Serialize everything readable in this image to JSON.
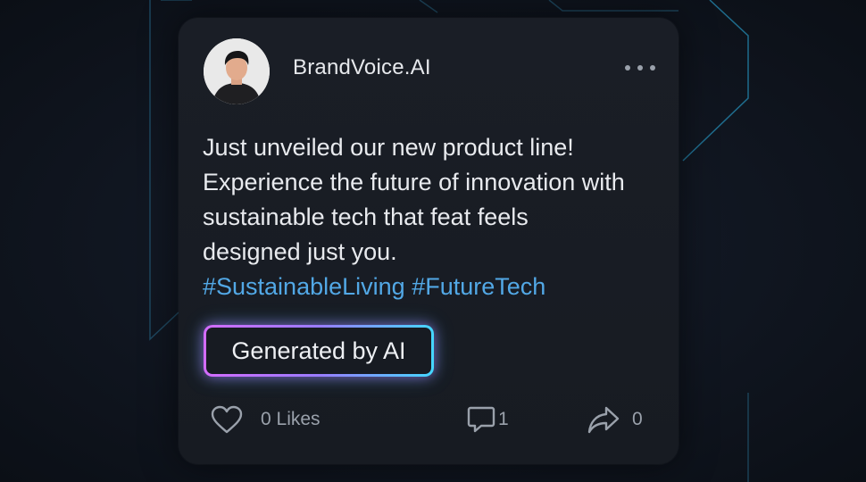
{
  "post": {
    "author": "BrandVoice.AI",
    "text_lines": [
      "Just unveiled our new product line!",
      "Experience the future of innovation with",
      "sustainable tech that feat feels",
      "designed just you."
    ],
    "hashtags": [
      "#SustainableLiving",
      "#FutureTech"
    ],
    "ai_badge": "Generated by AI"
  },
  "actions": {
    "likes_label": "0 Likes",
    "comments_count": "1",
    "shares_count": "0"
  },
  "icons": {
    "more": "more-horizontal-icon",
    "like": "heart-icon",
    "comment": "comment-icon",
    "share": "share-icon"
  },
  "colors": {
    "background": "#0d1117",
    "card": "#1a1e26",
    "hashtag": "#52a8e6",
    "badge_gradient_start": "#d46cff",
    "badge_gradient_end": "#44d7ff",
    "accent_glow": "#2aa8d8"
  }
}
